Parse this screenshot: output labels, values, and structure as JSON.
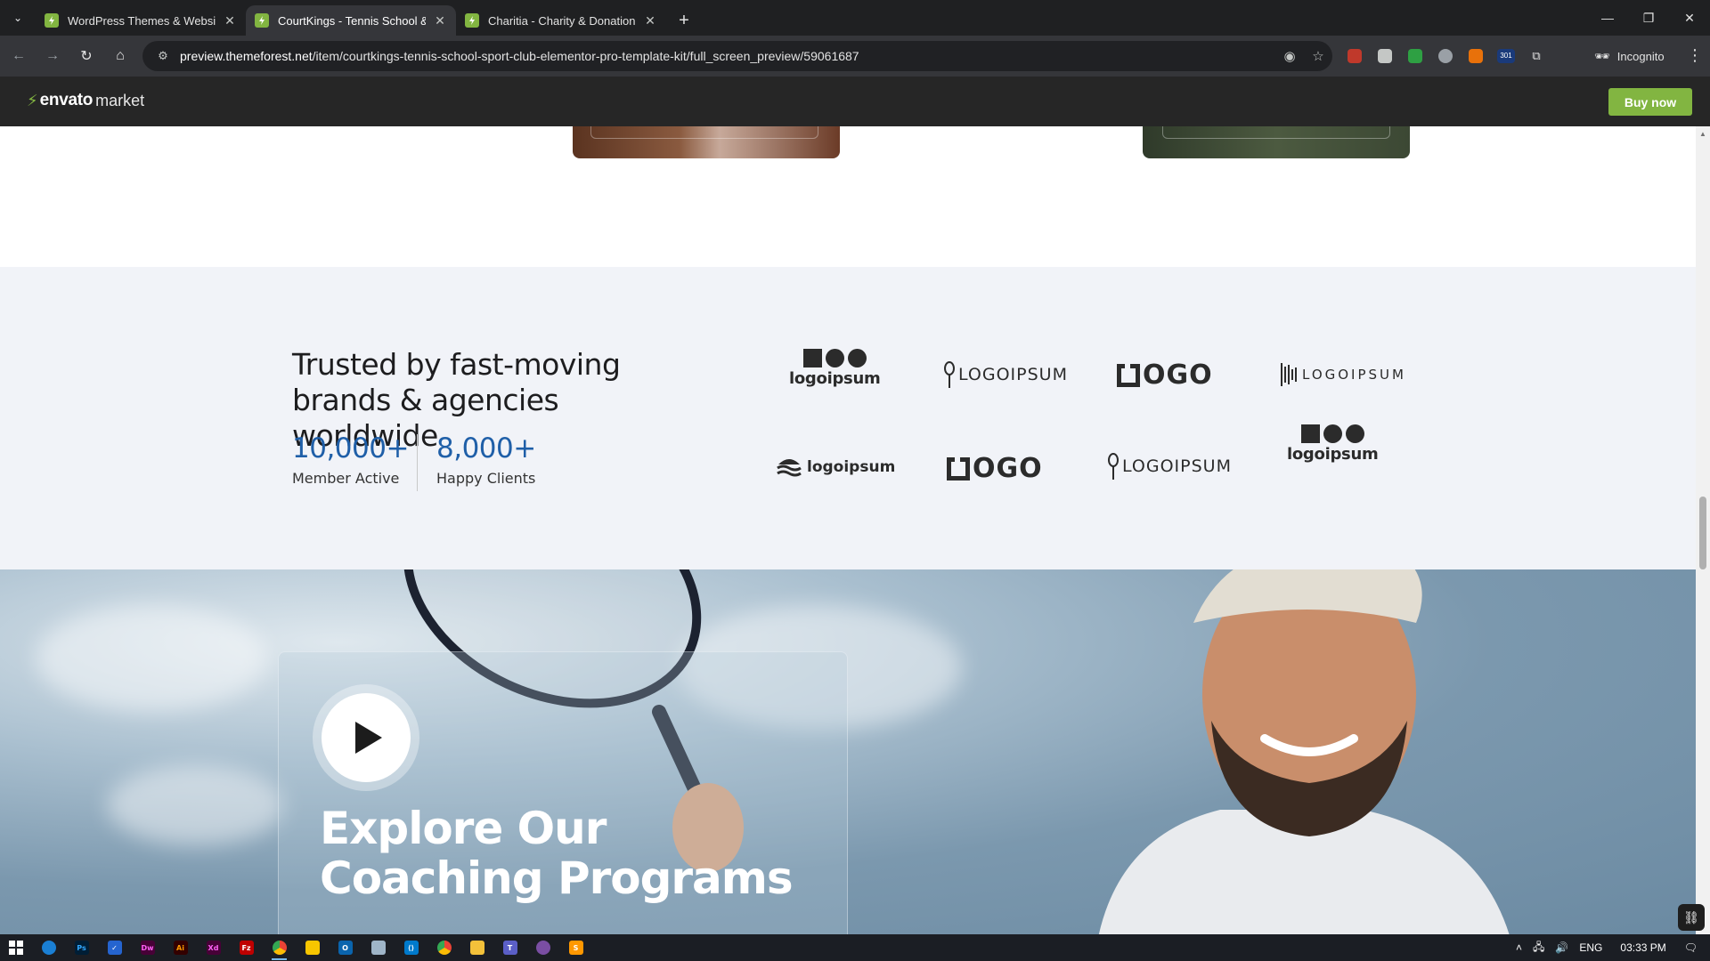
{
  "browser": {
    "tabs": [
      {
        "title": "WordPress Themes & Website T"
      },
      {
        "title": "CourtKings - Tennis School & Sp"
      },
      {
        "title": "Charitia - Charity & Donation S"
      }
    ],
    "url_domain": "preview.themeforest.net",
    "url_path": "/item/courtkings-tennis-school-sport-club-elementor-pro-template-kit/full_screen_preview/59061687",
    "incognito_label": "Incognito",
    "ext_badge": "301"
  },
  "envato": {
    "brand": "envato",
    "market": "market",
    "buy_label": "Buy now",
    "accent": "#82b541"
  },
  "trusted": {
    "heading": "Trusted by fast-moving brands & agencies worldwide",
    "stats": [
      {
        "value": "10,000+",
        "label": "Member Active"
      },
      {
        "value": "8,000+",
        "label": "Happy Clients"
      }
    ],
    "logos": [
      {
        "kind": "logoipsum-stacked",
        "text": "logoipsum"
      },
      {
        "kind": "logoipsum-pin",
        "text": "LOGOIPSUM"
      },
      {
        "kind": "logo-box",
        "text": "OGO"
      },
      {
        "kind": "logoipsum-bars",
        "text": "LOGOIPSUM"
      },
      {
        "kind": "logoipsum-wave",
        "text": "logoipsum"
      },
      {
        "kind": "logo-box",
        "text": "OGO"
      },
      {
        "kind": "logoipsum-pin",
        "text": "LOGOIPSUM"
      },
      {
        "kind": "logoipsum-stacked",
        "text": "logoipsum"
      }
    ]
  },
  "hero": {
    "heading": "Explore Our Coaching Programs"
  },
  "taskbar": {
    "apps": [
      "Edge",
      "Ps",
      "Todo",
      "Dw",
      "Ai",
      "Xd",
      "FileZilla",
      "Chrome",
      "Notes",
      "Outlook",
      "Notepad",
      "VS Code",
      "Chrome",
      "Explorer",
      "Teams",
      "Podcasts",
      "Sublime"
    ],
    "lang": "ENG",
    "time": "03:33 PM"
  }
}
